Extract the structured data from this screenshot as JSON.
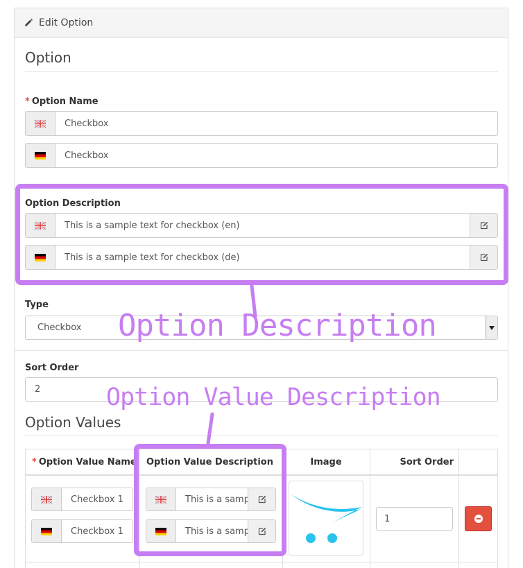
{
  "panel": {
    "heading": "Edit Option"
  },
  "section": {
    "legend": "Option"
  },
  "option_name": {
    "label": "Option Name",
    "values": [
      {
        "language": "English",
        "flag": "uk-flag-icon",
        "value": "Checkbox"
      },
      {
        "language": "Deutsch",
        "flag": "de-flag-icon",
        "value": "Checkbox"
      }
    ]
  },
  "option_description": {
    "label": "Option Description",
    "values": [
      {
        "language": "English",
        "flag": "uk-flag-icon",
        "value": "This is a sample text for checkbox (en)"
      },
      {
        "language": "Deutsch",
        "flag": "de-flag-icon",
        "value": "This is a sample text for checkbox (de)"
      }
    ]
  },
  "type": {
    "label": "Type",
    "selected": "Checkbox"
  },
  "sort_order": {
    "label": "Sort Order",
    "value": "2"
  },
  "option_values": {
    "legend": "Option Values",
    "columns": [
      "Option Value Name",
      "Option Value Description",
      "Image",
      "Sort Order"
    ],
    "rows": [
      {
        "names": [
          "Checkbox 1",
          "Checkbox 1"
        ],
        "descriptions": [
          "This is a sample text",
          "This is a sample text"
        ],
        "image": "opencart-cart-logo",
        "sort_order": "1"
      }
    ]
  },
  "annotations": {
    "option_description": "Option Description",
    "option_value_description": "Option Value Description",
    "color": "#c77ef2"
  },
  "colors": {
    "danger": "#e3503e",
    "required": "#e3503e",
    "logo": "#2ac3ee"
  }
}
